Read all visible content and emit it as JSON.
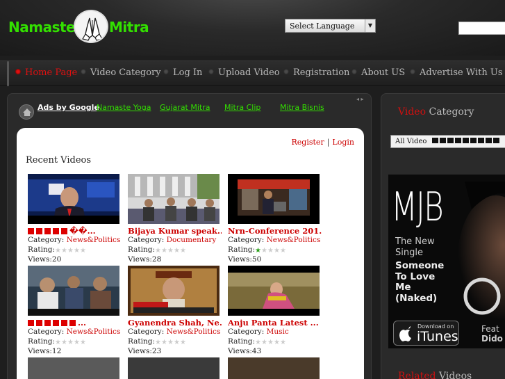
{
  "header": {
    "logo_left": "Namaste",
    "logo_right": "Mitra",
    "language_select": "Select Language"
  },
  "nav": {
    "items": [
      {
        "label": "Home Page",
        "active": true
      },
      {
        "label": "Video Category"
      },
      {
        "label": "Log In"
      },
      {
        "label": "Upload Video"
      },
      {
        "label": "Registration"
      },
      {
        "label": "About US"
      },
      {
        "label": "Advertise With Us"
      }
    ]
  },
  "ads": {
    "ads_by_google": "Ads by Google",
    "links": [
      "Namaste Yoga",
      "Gujarat Mitra",
      "Mitra Clip",
      "Mitra Bisnis"
    ]
  },
  "auth": {
    "register": "Register",
    "separator": "|",
    "login": "Login"
  },
  "recent": {
    "title": "Recent Videos",
    "category_label": "Category:",
    "rating_label": "Rating:",
    "views_label": "Views:",
    "videos": [
      {
        "title": "��...",
        "title_blocks": 5,
        "category": "News&Politics",
        "rating": 0,
        "views": "20"
      },
      {
        "title": "Bijaya Kumar speak...",
        "category": "Documentary",
        "rating": 0,
        "views": "28"
      },
      {
        "title": "Nrn-Conference 201...",
        "category": "News&Politics",
        "rating": 1,
        "views": "50"
      },
      {
        "title": "...",
        "title_blocks": 6,
        "category": "News&Politics",
        "rating": 0,
        "views": "12"
      },
      {
        "title": "Gyanendra Shah, Ne...",
        "category": "News&Politics",
        "rating": 0,
        "views": "23"
      },
      {
        "title": "Anju Panta Latest ...",
        "category": "Music",
        "rating": 0,
        "views": "43"
      }
    ]
  },
  "sidebar": {
    "video_category_hl": "Video",
    "video_category_rest": " Category",
    "category_select": "All Video",
    "related_hl": "Related",
    "related_rest": " Videos"
  },
  "mj_ad": {
    "logo": "MJB",
    "line1a": "The New",
    "line1b": "Single",
    "line2a": "Someone",
    "line2b": "To Love",
    "line2c": "Me",
    "line2d": "(Naked)",
    "itunes_small": "Download on",
    "itunes_big": "iTunes",
    "feat1": "Feat",
    "feat2": "Dido"
  },
  "colors": {
    "accent_red": "#cc0000",
    "logo_green": "#33e000",
    "background": "#1e1e1e"
  }
}
